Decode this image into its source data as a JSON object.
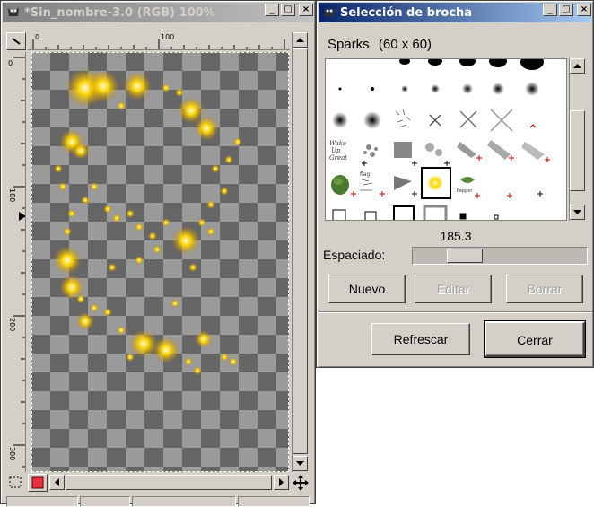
{
  "image_window": {
    "title": "*Sin_nombre-3.0 (RGB) 100%",
    "ruler_top_labels": [
      "0",
      "100"
    ],
    "ruler_left_labels": [
      "0",
      "100",
      "200",
      "300"
    ]
  },
  "brush_dialog": {
    "title": "Selección de brocha",
    "brush_name": "Sparks",
    "brush_size": "(60 x 60)",
    "spacing_label": "Espaciado:",
    "spacing_value": "185.3",
    "spacing_fraction": 0.25,
    "buttons": {
      "new": "Nuevo",
      "edit": "Editar",
      "delete": "Borrar",
      "refresh": "Refrescar",
      "close": "Cerrar"
    },
    "brush_sample_texts": [
      "Wake\nUp\nGreat",
      "flag",
      "Pepper"
    ]
  },
  "titlebar_buttons": {
    "minimize": "_",
    "maximize": "□",
    "close": "×"
  },
  "colors": {
    "active_title": "#0a246a",
    "inactive_title": "#808080",
    "face": "#d4d0c8",
    "spark": "#ffd000"
  }
}
